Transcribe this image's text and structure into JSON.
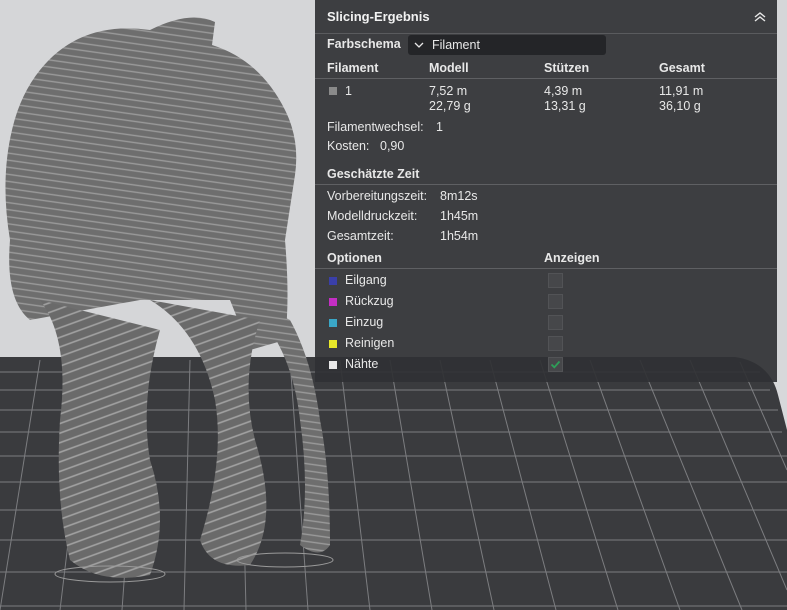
{
  "panel": {
    "title": "Slicing-Ergebnis",
    "color_scheme_label": "Farbschema",
    "color_scheme_value": "Filament",
    "table_headers": [
      "Filament",
      "Modell",
      "Stützen",
      "Gesamt"
    ],
    "filament_rows": [
      {
        "id": "1",
        "swatch_color": "#8a8a8a",
        "model_length": "7,52 m",
        "model_weight": "22,79 g",
        "support_length": "4,39 m",
        "support_weight": "13,31 g",
        "total_length": "11,91 m",
        "total_weight": "36,10 g"
      }
    ],
    "filament_changes_label": "Filamentwechsel:",
    "filament_changes_value": "1",
    "cost_label": "Kosten:",
    "cost_value": "0,90",
    "time_section_title": "Geschätzte Zeit",
    "times": [
      {
        "label": "Vorbereitungszeit:",
        "value": "8m12s"
      },
      {
        "label": "Modelldruckzeit:",
        "value": "1h45m"
      },
      {
        "label": "Gesamtzeit:",
        "value": "1h54m"
      }
    ],
    "options_header": "Optionen",
    "show_header": "Anzeigen",
    "options": [
      {
        "label": "Eilgang",
        "color": "#3a3fa8",
        "checked": false
      },
      {
        "label": "Rückzug",
        "color": "#c42ec4",
        "checked": false
      },
      {
        "label": "Einzug",
        "color": "#3aa6c6",
        "checked": false
      },
      {
        "label": "Reinigen",
        "color": "#e8e82a",
        "checked": false
      },
      {
        "label": "Nähte",
        "color": "#e8e8e8",
        "checked": true
      }
    ],
    "check_color": "#2e9e58"
  }
}
